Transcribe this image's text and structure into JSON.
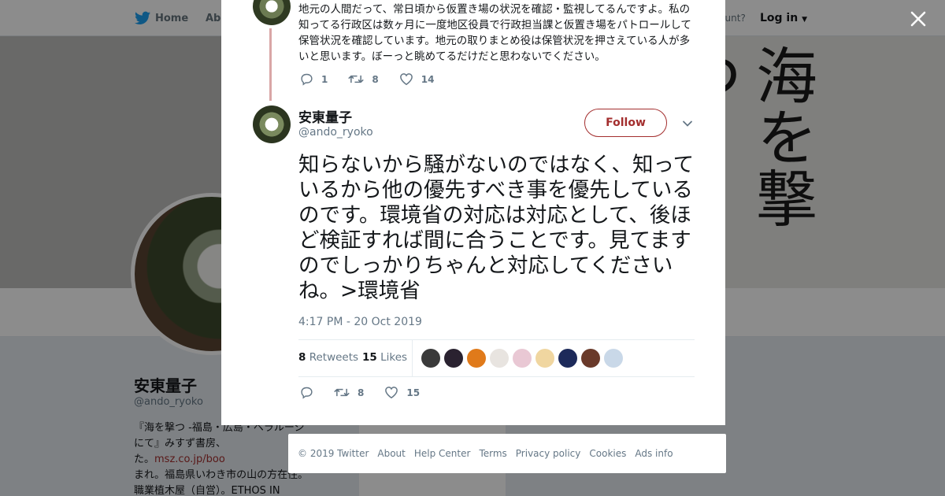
{
  "topbar": {
    "home_label": "Home",
    "about_label": "Abo",
    "account_prompt": "ccount?",
    "login_label": "Log in"
  },
  "banner": {
    "book_text": "海を撃つ"
  },
  "profile": {
    "name": "安東量子",
    "handle": "@ando_ryoko",
    "bio_line1": "『海を撃つ -福島・広島・ベラルーシにて』みすず書房、",
    "bio_line2": "た。",
    "bio_link": "msz.co.jp/boo",
    "bio_line3": "まれ。福島県いわき市の山の方在住。職業植木屋（自営）。ETHOS IN"
  },
  "modal": {
    "previous_tweet": {
      "text": "地元の人間だって、常日頃から仮置き場の状況を確認・監視してるんですよ。私の知ってる行政区は数ヶ月に一度地区役員で行政担当課と仮置き場をパトロールして保管状況を確認しています。地元の取りまとめ役は保管状況を押さえている人が多いと思います。ぼーっと眺めてるだけだと思わないでください。",
      "replies": "1",
      "retweets": "8",
      "likes": "14"
    },
    "tweet": {
      "name": "安東量子",
      "handle": "@ando_ryoko",
      "follow_label": "Follow",
      "text": "知らないから騒がないのではなく、知っているから他の優先すべき事を優先しているのです。環境省の対応は対応として、後ほど検証すれば間に合うことです。見てますのでしっかりちゃんと対応してくださいね。>環境省",
      "timestamp": "4:17 PM - 20 Oct 2019",
      "retweets_count": "8",
      "retweets_label": "Retweets",
      "likes_count": "15",
      "likes_label": "Likes",
      "action_retweets": "8",
      "action_likes": "15"
    },
    "liker_colors": [
      "#3a3a3a",
      "#2a2230",
      "#e07a1a",
      "#e8e4e0",
      "#e9c8d4",
      "#f0d6a0",
      "#1d2a5a",
      "#6a3a2a",
      "#c9d8e8"
    ]
  },
  "footer": {
    "links": [
      "© 2019 Twitter",
      "About",
      "Help Center",
      "Terms",
      "Privacy policy",
      "Cookies",
      "Ads info"
    ]
  },
  "colors": {
    "accent": "#a32e2e",
    "twitter_blue": "#1da1f2",
    "muted": "#657786"
  }
}
